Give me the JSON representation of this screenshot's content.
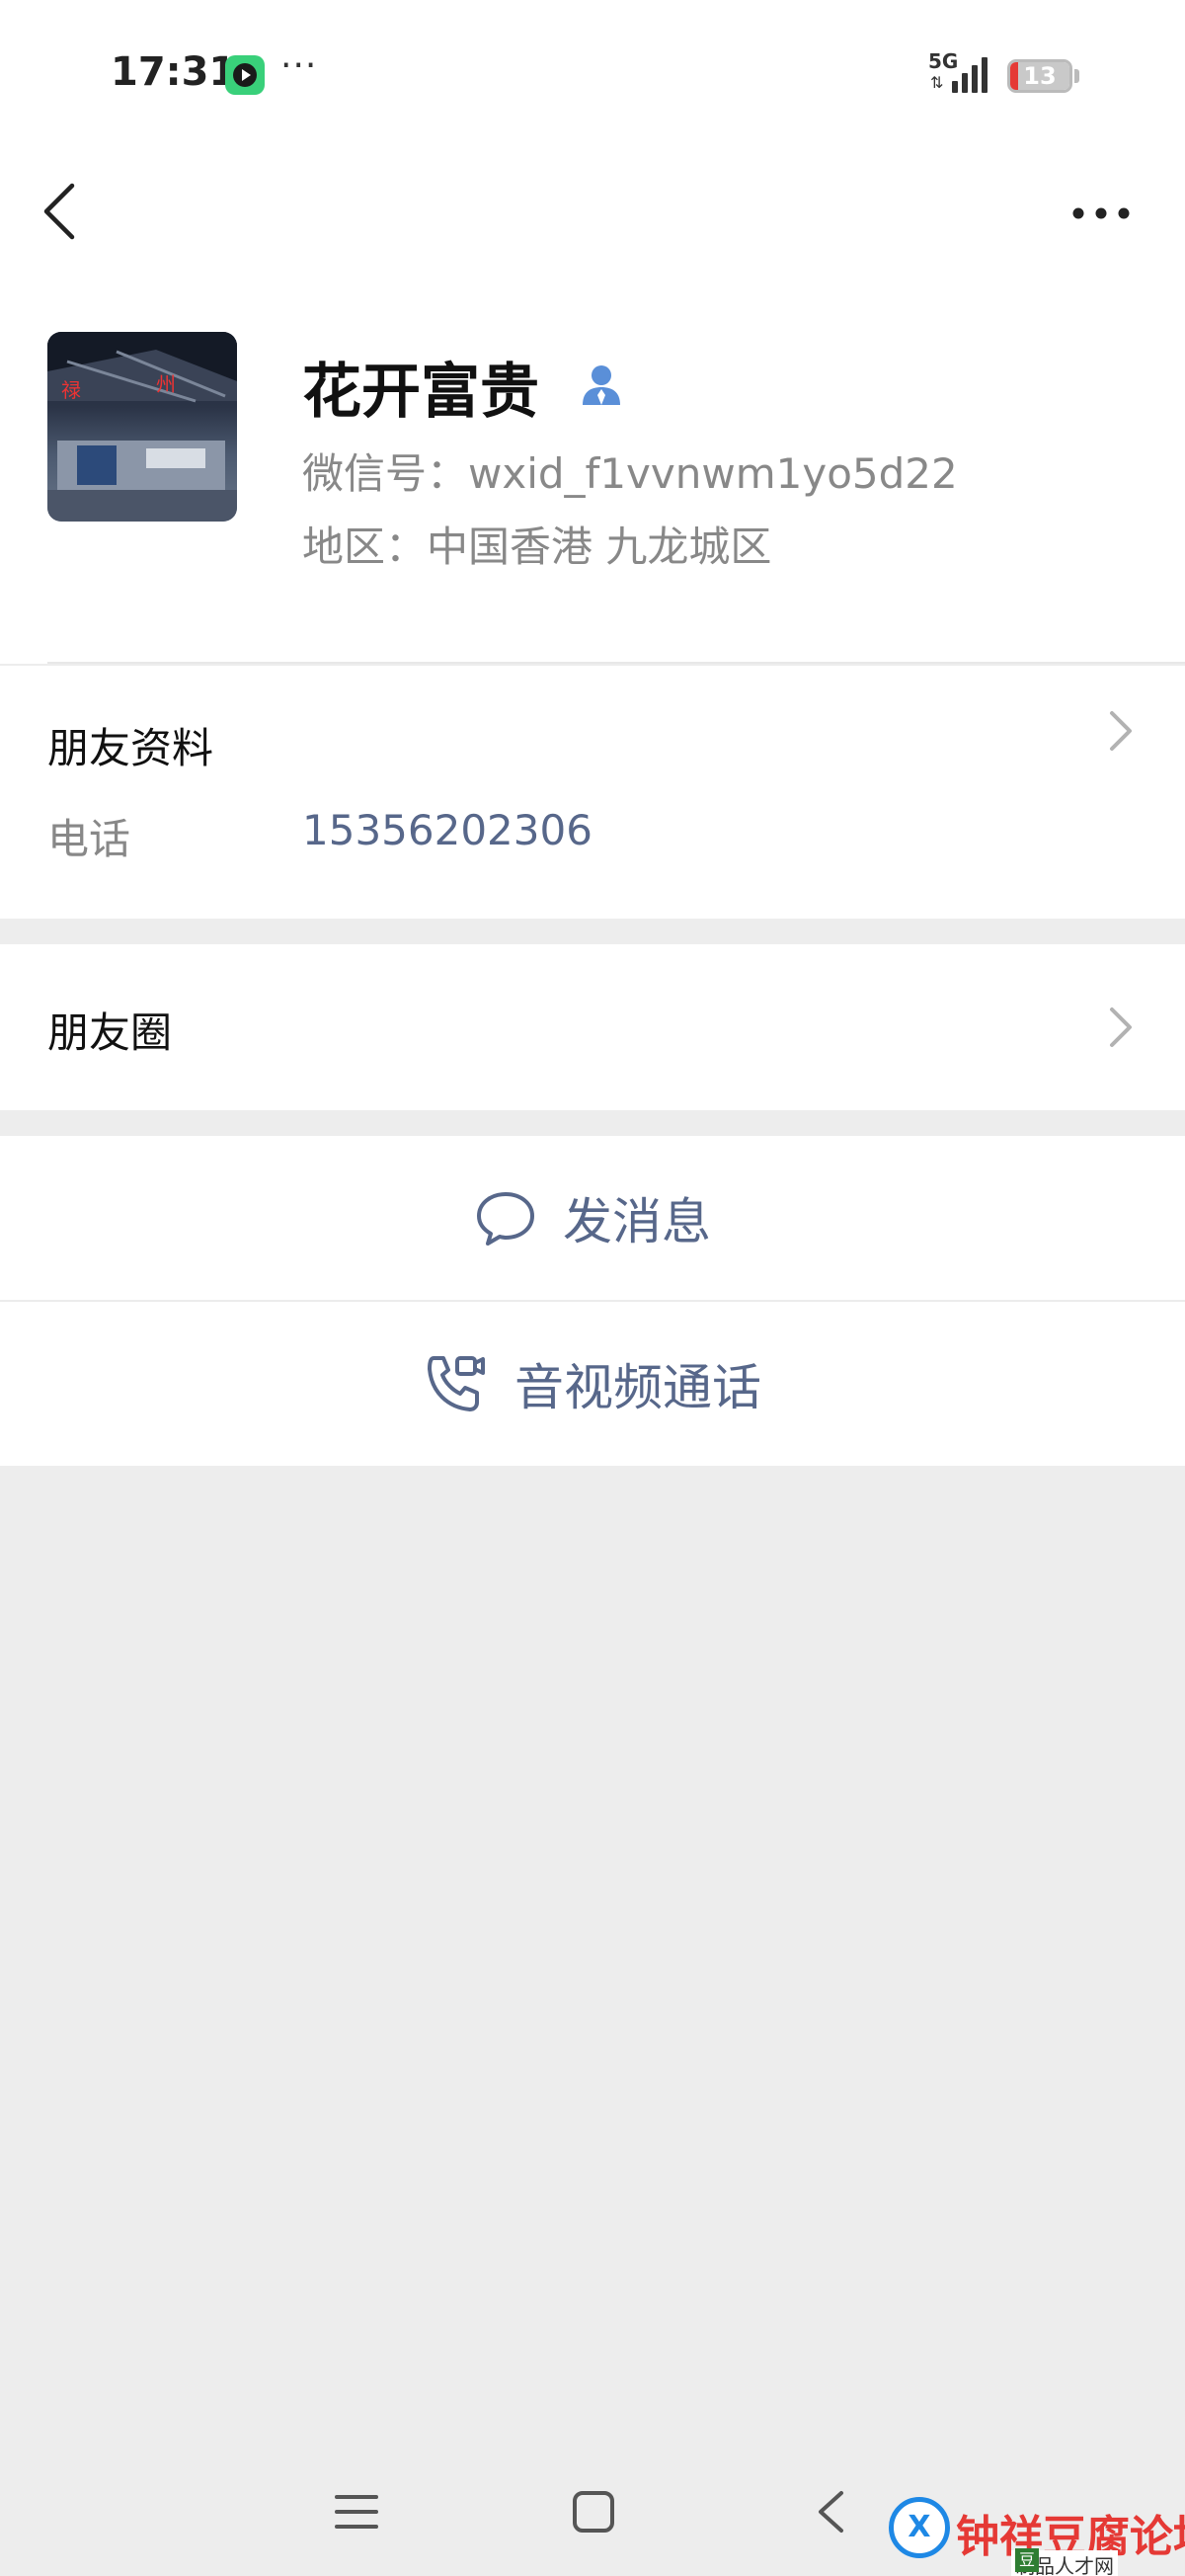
{
  "status_bar": {
    "time": "17:31",
    "dots": "···",
    "network": "5G",
    "network_arrows": "⇅",
    "battery": "13",
    "battery_level": 0.13
  },
  "profile": {
    "name": "花开富贵",
    "wxid": "微信号：wxid_f1vvnwm1yo5d22",
    "region": "地区：中国香港  九龙城区"
  },
  "friend_info": {
    "title": "朋友资料",
    "phone_label": "电话",
    "phone_value": "15356202306"
  },
  "moments": {
    "title": "朋友圈"
  },
  "actions": {
    "send_message": "发消息",
    "av_call": "音视频通话"
  },
  "watermark": {
    "logo": "X",
    "text": "钟祥豆腐论坛",
    "badge": "豆",
    "sub": "制品人才网"
  },
  "colors": {
    "link": "#57678a",
    "background": "#ededed",
    "verified": "#5a8fd8",
    "battery_low": "#e53935"
  }
}
